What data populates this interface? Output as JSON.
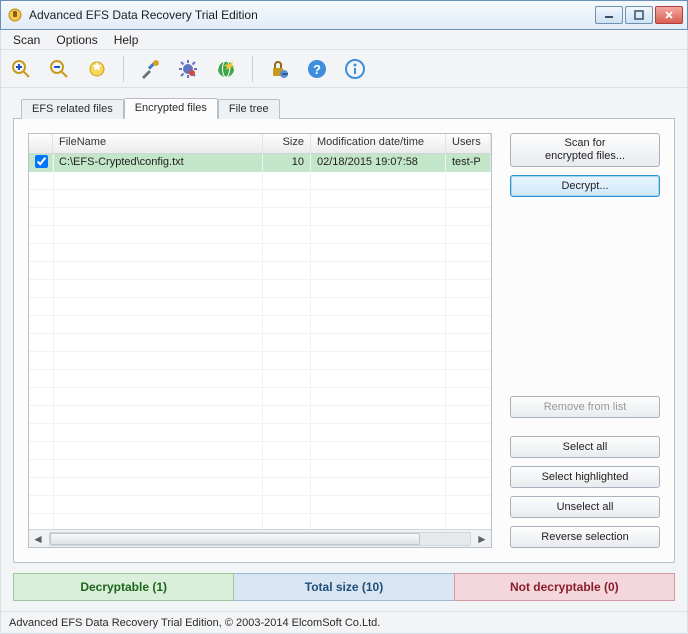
{
  "window": {
    "title": "Advanced EFS Data Recovery Trial Edition"
  },
  "menu": {
    "items": [
      "Scan",
      "Options",
      "Help"
    ]
  },
  "toolbar_icons": [
    "zoom-in-icon",
    "zoom-out-icon",
    "wizard-icon",
    "tools-icon",
    "settings-gear-icon",
    "globe-icon",
    "lock-key-icon",
    "help-icon",
    "info-icon"
  ],
  "tabs": {
    "items": [
      "EFS related files",
      "Encrypted files",
      "File tree"
    ],
    "active": 1
  },
  "grid": {
    "columns": [
      "",
      "FileName",
      "Size",
      "Modification date/time",
      "Users"
    ],
    "rows": [
      {
        "checked": true,
        "filename": "C:\\EFS-Crypted\\config.txt",
        "size": "10",
        "mtime": "02/18/2015 19:07:58",
        "users": "test-P"
      }
    ]
  },
  "buttons": {
    "scan": "Scan for\nencrypted files...",
    "decrypt": "Decrypt...",
    "remove": "Remove from list",
    "select_all": "Select all",
    "select_highlighted": "Select highlighted",
    "unselect_all": "Unselect all",
    "reverse": "Reverse selection"
  },
  "status": {
    "decryptable": "Decryptable (1)",
    "total": "Total size (10)",
    "not_decryptable": "Not decryptable (0)"
  },
  "statusbar": "Advanced EFS Data Recovery Trial Edition, © 2003-2014 ElcomSoft Co.Ltd."
}
